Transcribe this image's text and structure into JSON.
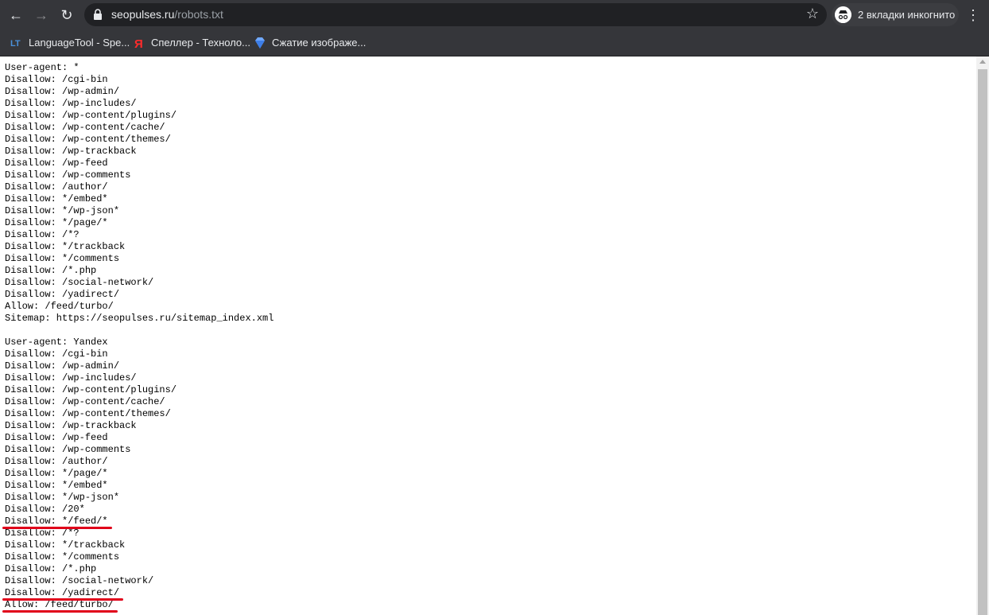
{
  "browser": {
    "back_icon": "arrow-left-icon",
    "forward_icon": "arrow-right-icon",
    "reload_icon": "reload-icon",
    "url_host": "seopulses.ru",
    "url_path": "/robots.txt",
    "incognito_label": "2 вкладки инкогнито",
    "menu_icon": "kebab-menu-icon"
  },
  "bookmarks": [
    {
      "label": "LanguageTool - Spe...",
      "icon": "languagetool-icon"
    },
    {
      "label": "Спеллер - Техноло...",
      "icon": "yandex-icon"
    },
    {
      "label": "Сжатие изображе...",
      "icon": "diamond-icon"
    }
  ],
  "robots_lines": [
    "User-agent: *",
    "Disallow: /cgi-bin",
    "Disallow: /wp-admin/",
    "Disallow: /wp-includes/",
    "Disallow: /wp-content/plugins/",
    "Disallow: /wp-content/cache/",
    "Disallow: /wp-content/themes/",
    "Disallow: /wp-trackback",
    "Disallow: /wp-feed",
    "Disallow: /wp-comments",
    "Disallow: /author/",
    "Disallow: */embed*",
    "Disallow: */wp-json*",
    "Disallow: */page/*",
    "Disallow: /*?",
    "Disallow: */trackback",
    "Disallow: */comments",
    "Disallow: /*.php",
    "Disallow: /social-network/",
    "Disallow: /yadirect/",
    "Allow: /feed/turbo/",
    "Sitemap: https://seopulses.ru/sitemap_index.xml",
    "",
    "User-agent: Yandex",
    "Disallow: /cgi-bin",
    "Disallow: /wp-admin/",
    "Disallow: /wp-includes/",
    "Disallow: /wp-content/plugins/",
    "Disallow: /wp-content/cache/",
    "Disallow: /wp-content/themes/",
    "Disallow: /wp-trackback",
    "Disallow: /wp-feed",
    "Disallow: /wp-comments",
    "Disallow: /author/",
    "Disallow: */page/*",
    "Disallow: */embed*",
    "Disallow: */wp-json*",
    "Disallow: /20*",
    "Disallow: */feed/*",
    "Disallow: /*?",
    "Disallow: */trackback",
    "Disallow: */comments",
    "Disallow: /*.php",
    "Disallow: /social-network/",
    "Disallow: /yadirect/",
    "Allow: /feed/turbo/"
  ],
  "highlighted_lines": [
    38,
    44,
    45
  ],
  "highlight_color": "#e0001a"
}
